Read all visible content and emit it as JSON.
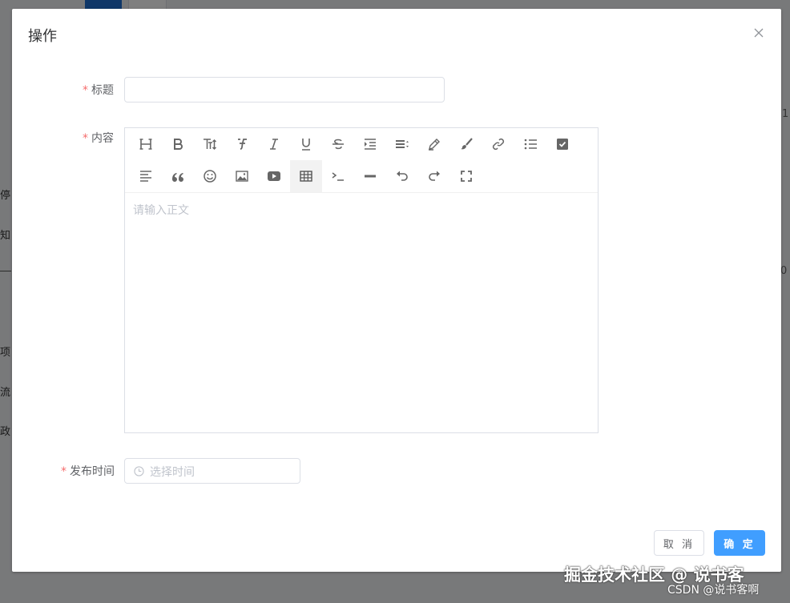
{
  "background": {
    "side_texts": [
      "停",
      "知",
      "项",
      "流",
      "政"
    ],
    "right_marks": [
      "1",
      "0"
    ]
  },
  "dialog": {
    "title": "操作",
    "close_icon": "close-icon"
  },
  "form": {
    "required_mark": "*",
    "title_label": "标题",
    "title_value": "",
    "content_label": "内容",
    "content_placeholder": "请输入正文",
    "date_label": "发布时间",
    "date_placeholder": "选择时间"
  },
  "toolbar": {
    "icons": [
      "header-icon",
      "bold-icon",
      "font-size-icon",
      "font-family-icon",
      "italic-icon",
      "underline-icon",
      "strikethrough-icon",
      "indent-icon",
      "line-height-icon",
      "fore-color-icon",
      "back-color-icon",
      "link-icon",
      "list-icon",
      "todo-icon",
      "justify-icon",
      "quote-icon",
      "emoticon-icon",
      "image-icon",
      "video-icon",
      "table-icon",
      "code-icon",
      "divider-icon",
      "undo-icon",
      "redo-icon",
      "fullscreen-icon"
    ],
    "active": "table-icon"
  },
  "footer": {
    "cancel_label": "取 消",
    "ok_label": "确 定"
  },
  "colors": {
    "primary": "#409eff",
    "required": "#f56c6c",
    "placeholder": "#c0c4cc"
  },
  "watermark": {
    "line1": "掘金技术社区 @ 说书客",
    "line2": "CSDN @说书客啊"
  }
}
